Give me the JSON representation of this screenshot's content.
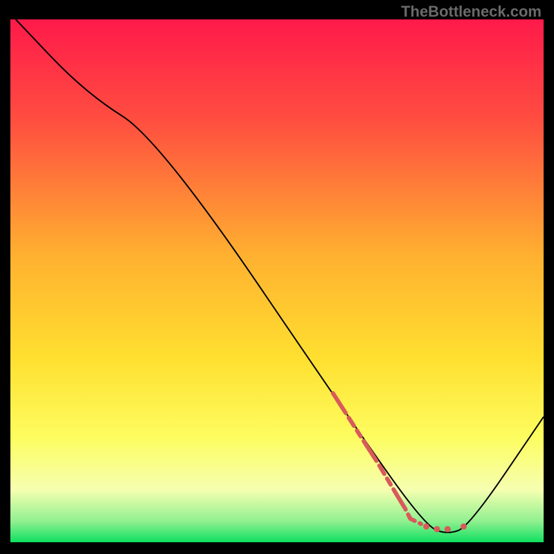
{
  "watermark": "TheBottleneck.com",
  "chart_data": {
    "type": "line",
    "title": "",
    "xlabel": "",
    "ylabel": "",
    "xlim": [
      0,
      100
    ],
    "ylim": [
      0,
      100
    ],
    "gradient_stops": [
      {
        "offset": 0,
        "color": "#ff1a4a"
      },
      {
        "offset": 20,
        "color": "#ff5040"
      },
      {
        "offset": 45,
        "color": "#ffb030"
      },
      {
        "offset": 65,
        "color": "#ffe030"
      },
      {
        "offset": 80,
        "color": "#fdfd60"
      },
      {
        "offset": 90,
        "color": "#f5ffb0"
      },
      {
        "offset": 96,
        "color": "#90f090"
      },
      {
        "offset": 100,
        "color": "#0ee060"
      }
    ],
    "series": [
      {
        "name": "bottleneck-curve",
        "color": "#000000",
        "width": 2,
        "points": [
          {
            "x": 1,
            "y": 100
          },
          {
            "x": 14,
            "y": 86
          },
          {
            "x": 28,
            "y": 77
          },
          {
            "x": 66,
            "y": 20
          },
          {
            "x": 78,
            "y": 3
          },
          {
            "x": 82,
            "y": 1.5
          },
          {
            "x": 86,
            "y": 3
          },
          {
            "x": 100,
            "y": 24
          }
        ]
      },
      {
        "name": "highlight-dashes",
        "color": "#d85a5a",
        "width": 6,
        "style": "dashed",
        "points": [
          {
            "x": 60.5,
            "y": 28.5
          },
          {
            "x": 69,
            "y": 15
          },
          {
            "x": 72.5,
            "y": 9
          },
          {
            "x": 74,
            "y": 6.5
          },
          {
            "x": 75,
            "y": 4.5
          },
          {
            "x": 77,
            "y": 3.5
          }
        ]
      },
      {
        "name": "highlight-dots",
        "color": "#d85a5a",
        "radius": 4.5,
        "points": [
          {
            "x": 78,
            "y": 3
          },
          {
            "x": 80,
            "y": 2.5
          },
          {
            "x": 82,
            "y": 2.5
          },
          {
            "x": 85,
            "y": 3
          }
        ]
      }
    ]
  }
}
